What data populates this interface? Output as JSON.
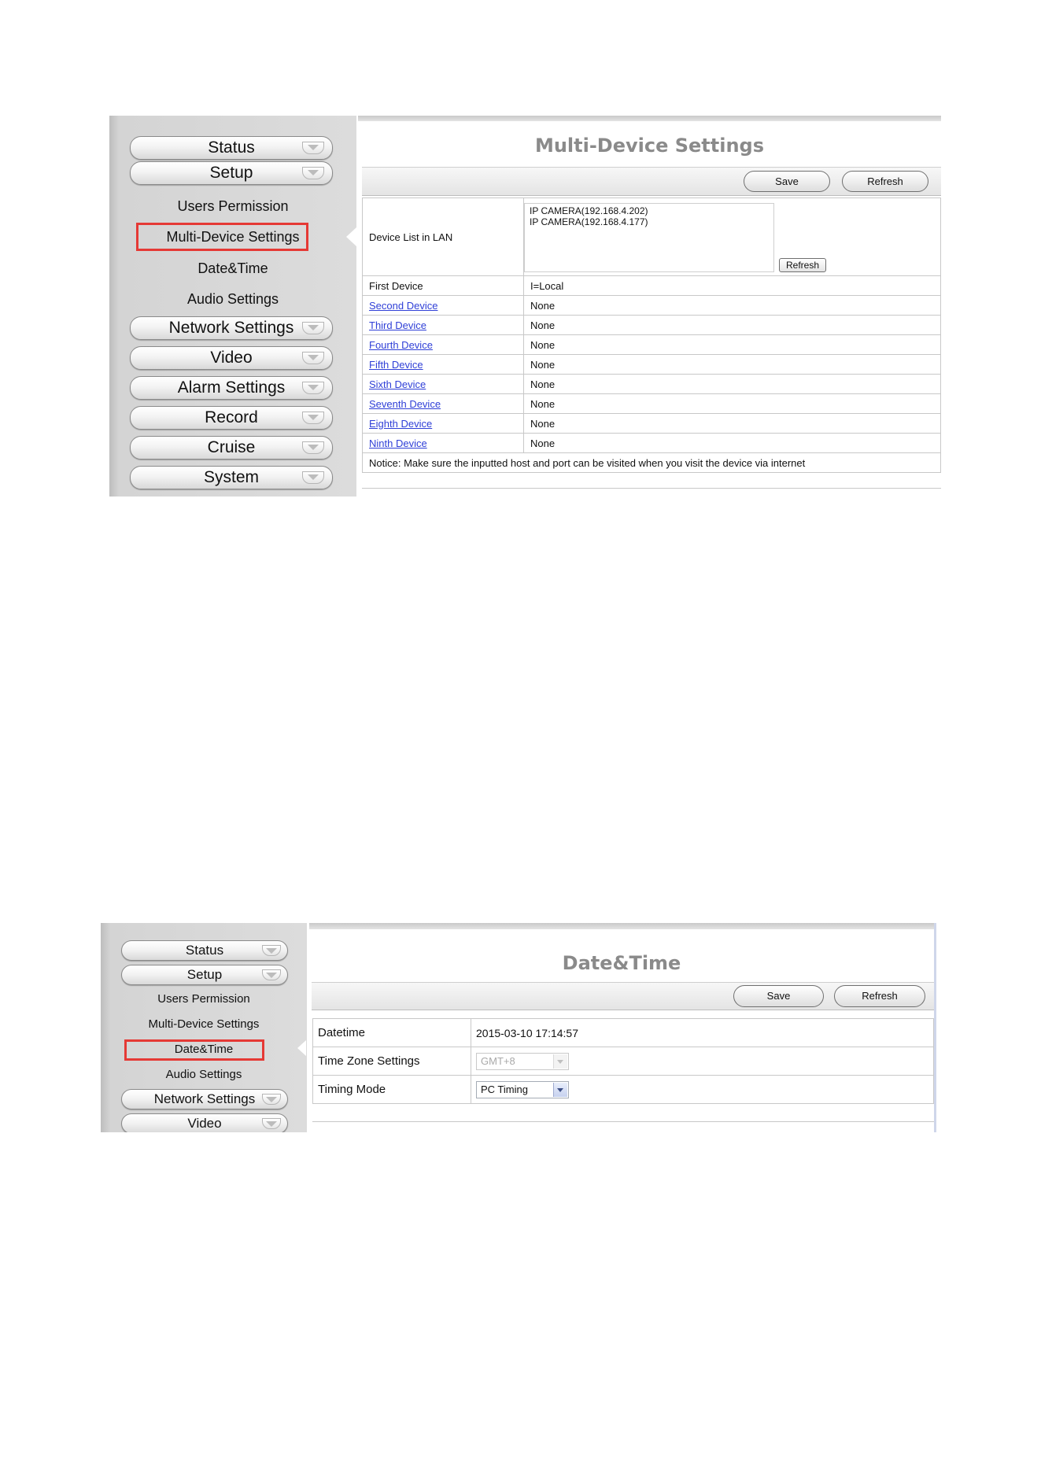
{
  "shot1": {
    "nav": {
      "status": "Status",
      "setup": "Setup",
      "users_permission": "Users Permission",
      "multi_device": "Multi-Device Settings",
      "date_time": "Date&Time",
      "audio_settings": "Audio Settings",
      "network_settings": "Network Settings",
      "video": "Video",
      "alarm_settings": "Alarm Settings",
      "record": "Record",
      "cruise": "Cruise",
      "system": "System"
    },
    "title": "Multi-Device Settings",
    "save": "Save",
    "refresh": "Refresh",
    "lan_label": "Device List in LAN",
    "lan_devices": [
      "IP CAMERA(192.168.4.202)",
      "IP CAMERA(192.168.4.177)"
    ],
    "lan_refresh": "Refresh",
    "devices": [
      {
        "label": "First Device",
        "value": "I=Local"
      },
      {
        "label": "Second Device",
        "value": "None"
      },
      {
        "label": "Third Device",
        "value": "None"
      },
      {
        "label": "Fourth Device",
        "value": "None"
      },
      {
        "label": "Fifth Device",
        "value": "None"
      },
      {
        "label": "Sixth Device",
        "value": "None"
      },
      {
        "label": "Seventh Device",
        "value": "None"
      },
      {
        "label": "Eighth Device",
        "value": "None"
      },
      {
        "label": "Ninth Device",
        "value": "None"
      }
    ],
    "notice": "Notice: Make sure the inputted host and port can be visited when you visit the device via internet"
  },
  "shot2": {
    "nav": {
      "status": "Status",
      "setup": "Setup",
      "users_permission": "Users Permission",
      "multi_device": "Multi-Device Settings",
      "date_time": "Date&Time",
      "audio_settings": "Audio Settings",
      "network_settings": "Network Settings",
      "video": "Video"
    },
    "title": "Date&Time",
    "save": "Save",
    "refresh": "Refresh",
    "datetime_label": "Datetime",
    "datetime_value": "2015-03-10 17:14:57",
    "tz_label": "Time Zone Settings",
    "tz_value": "GMT+8",
    "timing_label": "Timing Mode",
    "timing_value": "PC Timing"
  },
  "colors": {
    "highlight": "#e53935",
    "link": "#2f3fd7",
    "title": "#8a8a8a"
  }
}
